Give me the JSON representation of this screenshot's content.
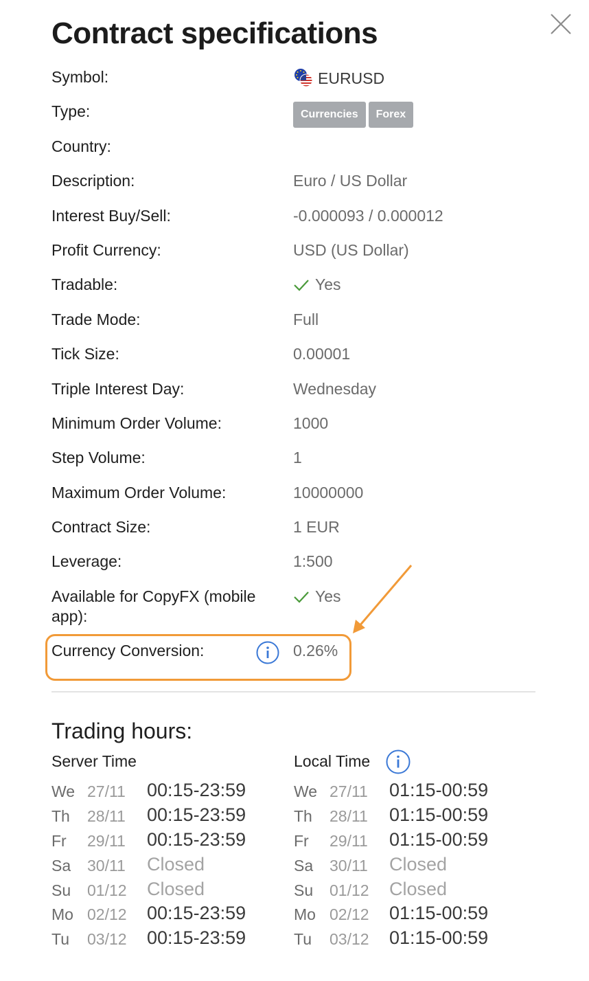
{
  "title": "Contract specifications",
  "specs": [
    {
      "label": "Symbol:",
      "value": "EURUSD",
      "kind": "symbol"
    },
    {
      "label": "Type:",
      "badges": [
        "Currencies",
        "Forex"
      ],
      "kind": "badges"
    },
    {
      "label": "Country:",
      "value": ""
    },
    {
      "label": "Description:",
      "value": "Euro / US Dollar"
    },
    {
      "label": "Interest Buy/Sell:",
      "value": "-0.000093 / 0.000012"
    },
    {
      "label": "Profit Currency:",
      "value": "USD (US Dollar)"
    },
    {
      "label": "Tradable:",
      "value": "Yes",
      "kind": "check"
    },
    {
      "label": "Trade Mode:",
      "value": "Full"
    },
    {
      "label": "Tick Size:",
      "value": "0.00001"
    },
    {
      "label": "Triple Interest Day:",
      "value": "Wednesday"
    },
    {
      "label": "Minimum Order Volume:",
      "value": "1000"
    },
    {
      "label": "Step Volume:",
      "value": "1"
    },
    {
      "label": "Maximum Order Volume:",
      "value": "10000000"
    },
    {
      "label": "Contract Size:",
      "value": "1 EUR"
    },
    {
      "label": "Leverage:",
      "value": "1:500"
    },
    {
      "label": "Available for CopyFX (mobile app):",
      "value": "Yes",
      "kind": "check"
    },
    {
      "label": "Currency Conversion:",
      "value": "0.26%",
      "kind": "info"
    }
  ],
  "trading_hours": {
    "title": "Trading hours:",
    "server_label": "Server Time",
    "local_label": "Local Time",
    "server": [
      {
        "day": "We",
        "date": "27/11",
        "time": "00:15-23:59"
      },
      {
        "day": "Th",
        "date": "28/11",
        "time": "00:15-23:59"
      },
      {
        "day": "Fr",
        "date": "29/11",
        "time": "00:15-23:59"
      },
      {
        "day": "Sa",
        "date": "30/11",
        "time": "Closed"
      },
      {
        "day": "Su",
        "date": "01/12",
        "time": "Closed"
      },
      {
        "day": "Mo",
        "date": "02/12",
        "time": "00:15-23:59"
      },
      {
        "day": "Tu",
        "date": "03/12",
        "time": "00:15-23:59"
      }
    ],
    "local": [
      {
        "day": "We",
        "date": "27/11",
        "time": "01:15-00:59"
      },
      {
        "day": "Th",
        "date": "28/11",
        "time": "01:15-00:59"
      },
      {
        "day": "Fr",
        "date": "29/11",
        "time": "01:15-00:59"
      },
      {
        "day": "Sa",
        "date": "30/11",
        "time": "Closed"
      },
      {
        "day": "Su",
        "date": "01/12",
        "time": "Closed"
      },
      {
        "day": "Mo",
        "date": "02/12",
        "time": "01:15-00:59"
      },
      {
        "day": "Tu",
        "date": "03/12",
        "time": "01:15-00:59"
      }
    ]
  },
  "colors": {
    "highlight": "#f19a38",
    "info": "#3a78d6",
    "check": "#4a9a3a",
    "badge": "#a6a9ad"
  },
  "icons": {
    "close": "close-icon",
    "info": "info-icon",
    "check": "check-icon",
    "flag": "eu-us-flag-icon"
  }
}
